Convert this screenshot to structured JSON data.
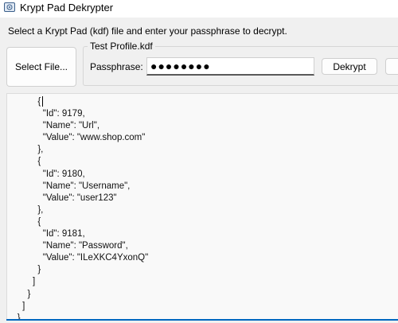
{
  "window": {
    "title": "Krypt Pad Dekrypter",
    "icon": "vault-icon"
  },
  "instruction": "Select a Krypt Pad (kdf) file and enter your passphrase to decrypt.",
  "select_button": {
    "label": "Select File..."
  },
  "profile_group": {
    "legend": "Test Profile.kdf",
    "passphrase_label": "Passphrase:",
    "passphrase_value": "●●●●●●●●",
    "dekrypt_label": "Dekrypt"
  },
  "output": {
    "lines": [
      "            {",
      "              \"Id\": 9179,",
      "              \"Name\": \"Url\",",
      "              \"Value\": \"www.shop.com\"",
      "            },",
      "            {",
      "              \"Id\": 9180,",
      "              \"Name\": \"Username\",",
      "              \"Value\": \"user123\"",
      "            },",
      "            {",
      "              \"Id\": 9181,",
      "              \"Name\": \"Password\",",
      "              \"Value\": \"ILeXKC4YxonQ\"",
      "            }",
      "          ]",
      "        }",
      "      ]",
      "    }"
    ]
  }
}
